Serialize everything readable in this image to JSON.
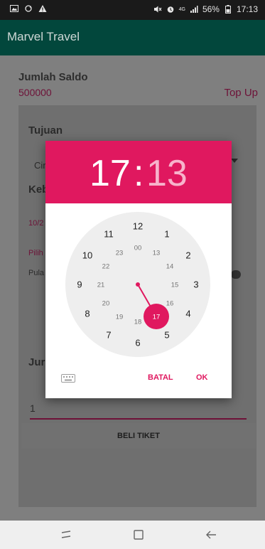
{
  "status_bar": {
    "battery": "56%",
    "time": "17:13",
    "network": "4G",
    "icons": [
      "image-icon",
      "sync-icon",
      "warning-icon",
      "mute-icon",
      "alarm-icon",
      "signal-icon",
      "battery-icon"
    ]
  },
  "app_bar": {
    "title": "Marvel Travel"
  },
  "main": {
    "saldo_label": "Jumlah Saldo",
    "saldo_value": "500000",
    "topup_label": "Top Up",
    "tujuan_label": "Tujuan",
    "tujuan_selected": "Cir",
    "keberangkatan_label": "Keb",
    "date_value": "10/2",
    "time_value": "Pilih",
    "pulang_label": "Pula",
    "jumlah_label": "Jur",
    "jumlah_value": "1",
    "beli_button": "BELI TIKET"
  },
  "dialog": {
    "hour": "17",
    "minute": "13",
    "separator": ":",
    "outer_numbers": [
      "12",
      "1",
      "2",
      "3",
      "4",
      "5",
      "6",
      "7",
      "8",
      "9",
      "10",
      "11"
    ],
    "inner_numbers": [
      "00",
      "13",
      "14",
      "15",
      "16",
      "17",
      "18",
      "19",
      "20",
      "21",
      "22",
      "23"
    ],
    "selected_value": "17",
    "cancel_label": "BATAL",
    "ok_label": "OK"
  },
  "colors": {
    "accent": "#e0185f",
    "app_bar": "#02473c",
    "dial_face": "#eeeeee"
  }
}
